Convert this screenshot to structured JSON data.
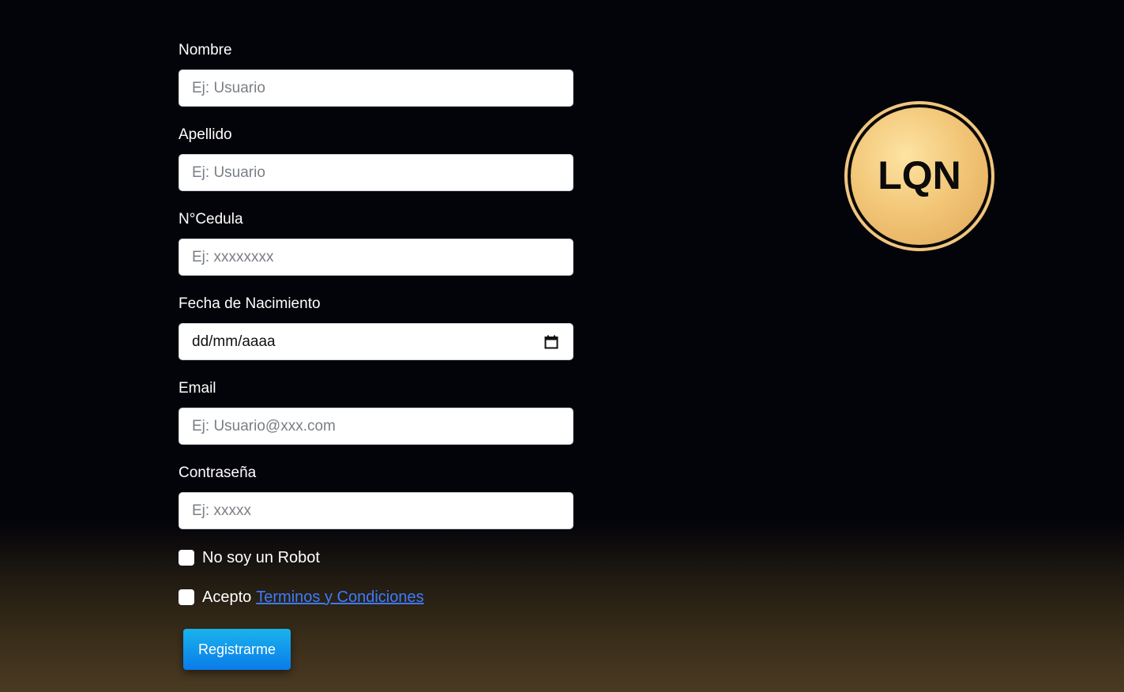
{
  "form": {
    "nombre": {
      "label": "Nombre",
      "placeholder": "Ej: Usuario"
    },
    "apellido": {
      "label": "Apellido",
      "placeholder": "Ej: Usuario"
    },
    "cedula": {
      "label": "N°Cedula",
      "placeholder": "Ej: xxxxxxxx"
    },
    "fecha": {
      "label": "Fecha de Nacimiento",
      "value": "dd/mm/aaaa"
    },
    "email": {
      "label": "Email",
      "placeholder": "Ej: Usuario@xxx.com"
    },
    "password": {
      "label": "Contraseña",
      "placeholder": "Ej: xxxxx"
    },
    "robot_check": {
      "label": "No soy un Robot",
      "checked": false
    },
    "terms_check": {
      "label": "Acepto",
      "link": "Terminos y Condiciones",
      "checked": false
    },
    "submit_label": "Registrarme"
  },
  "logo": {
    "text": "LQN"
  },
  "colors": {
    "background": "#03030a",
    "background_bottom": "#4a3a22",
    "button": "#0f8dee",
    "link": "#3d7bff",
    "logo_gold": "#f2c677"
  },
  "icons": {
    "date_picker": "calendar-icon"
  }
}
